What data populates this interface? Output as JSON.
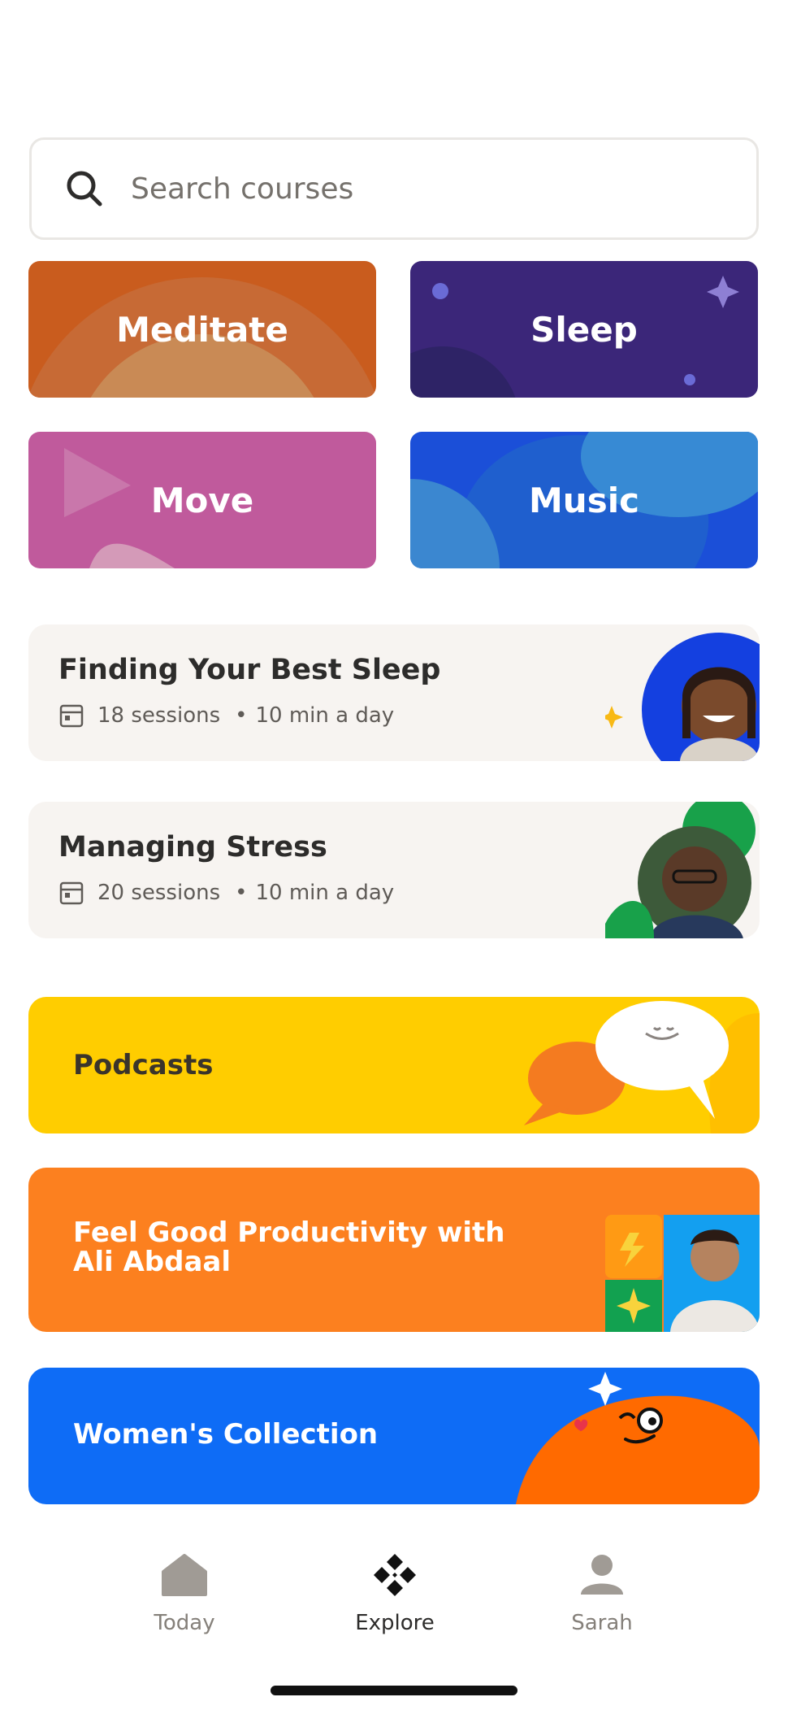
{
  "search": {
    "placeholder": "Search courses",
    "icon": "search-icon"
  },
  "categories": [
    {
      "label": "Meditate",
      "color": "#c95c1e"
    },
    {
      "label": "Sleep",
      "color": "#3b2679"
    },
    {
      "label": "Move",
      "color": "#c05a9c"
    },
    {
      "label": "Music",
      "color": "#1b4fd8"
    }
  ],
  "courses": [
    {
      "title": "Finding Your Best Sleep",
      "sessions": "18 sessions",
      "duration": "10 min a day",
      "icon": "calendar-icon"
    },
    {
      "title": "Managing Stress",
      "sessions": "20 sessions",
      "duration": "10 min a day",
      "icon": "calendar-icon"
    }
  ],
  "banners": [
    {
      "label": "Podcasts",
      "color": "#ffcd00"
    },
    {
      "label": "Feel Good Productivity with Ali Abdaal",
      "color": "#fc801f"
    },
    {
      "label": "Women's Collection",
      "color": "#0e6cf6"
    }
  ],
  "tabbar": {
    "items": [
      {
        "label": "Today",
        "icon": "home-icon"
      },
      {
        "label": "Explore",
        "icon": "explore-icon",
        "active": true
      },
      {
        "label": "Sarah",
        "icon": "profile-icon"
      }
    ]
  }
}
